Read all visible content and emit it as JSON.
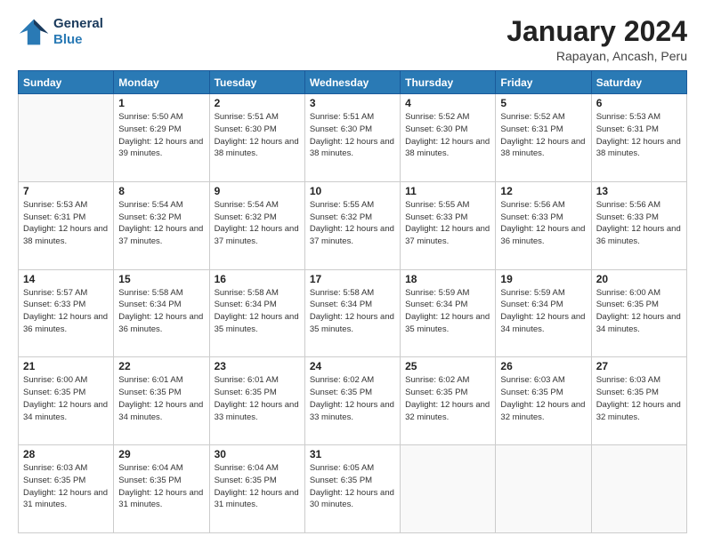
{
  "logo": {
    "line1": "General",
    "line2": "Blue"
  },
  "title": "January 2024",
  "subtitle": "Rapayan, Ancash, Peru",
  "days_header": [
    "Sunday",
    "Monday",
    "Tuesday",
    "Wednesday",
    "Thursday",
    "Friday",
    "Saturday"
  ],
  "weeks": [
    [
      {
        "day": "",
        "info": ""
      },
      {
        "day": "1",
        "info": "Sunrise: 5:50 AM\nSunset: 6:29 PM\nDaylight: 12 hours\nand 39 minutes."
      },
      {
        "day": "2",
        "info": "Sunrise: 5:51 AM\nSunset: 6:30 PM\nDaylight: 12 hours\nand 38 minutes."
      },
      {
        "day": "3",
        "info": "Sunrise: 5:51 AM\nSunset: 6:30 PM\nDaylight: 12 hours\nand 38 minutes."
      },
      {
        "day": "4",
        "info": "Sunrise: 5:52 AM\nSunset: 6:30 PM\nDaylight: 12 hours\nand 38 minutes."
      },
      {
        "day": "5",
        "info": "Sunrise: 5:52 AM\nSunset: 6:31 PM\nDaylight: 12 hours\nand 38 minutes."
      },
      {
        "day": "6",
        "info": "Sunrise: 5:53 AM\nSunset: 6:31 PM\nDaylight: 12 hours\nand 38 minutes."
      }
    ],
    [
      {
        "day": "7",
        "info": "Sunrise: 5:53 AM\nSunset: 6:31 PM\nDaylight: 12 hours\nand 38 minutes."
      },
      {
        "day": "8",
        "info": "Sunrise: 5:54 AM\nSunset: 6:32 PM\nDaylight: 12 hours\nand 37 minutes."
      },
      {
        "day": "9",
        "info": "Sunrise: 5:54 AM\nSunset: 6:32 PM\nDaylight: 12 hours\nand 37 minutes."
      },
      {
        "day": "10",
        "info": "Sunrise: 5:55 AM\nSunset: 6:32 PM\nDaylight: 12 hours\nand 37 minutes."
      },
      {
        "day": "11",
        "info": "Sunrise: 5:55 AM\nSunset: 6:33 PM\nDaylight: 12 hours\nand 37 minutes."
      },
      {
        "day": "12",
        "info": "Sunrise: 5:56 AM\nSunset: 6:33 PM\nDaylight: 12 hours\nand 36 minutes."
      },
      {
        "day": "13",
        "info": "Sunrise: 5:56 AM\nSunset: 6:33 PM\nDaylight: 12 hours\nand 36 minutes."
      }
    ],
    [
      {
        "day": "14",
        "info": "Sunrise: 5:57 AM\nSunset: 6:33 PM\nDaylight: 12 hours\nand 36 minutes."
      },
      {
        "day": "15",
        "info": "Sunrise: 5:58 AM\nSunset: 6:34 PM\nDaylight: 12 hours\nand 36 minutes."
      },
      {
        "day": "16",
        "info": "Sunrise: 5:58 AM\nSunset: 6:34 PM\nDaylight: 12 hours\nand 35 minutes."
      },
      {
        "day": "17",
        "info": "Sunrise: 5:58 AM\nSunset: 6:34 PM\nDaylight: 12 hours\nand 35 minutes."
      },
      {
        "day": "18",
        "info": "Sunrise: 5:59 AM\nSunset: 6:34 PM\nDaylight: 12 hours\nand 35 minutes."
      },
      {
        "day": "19",
        "info": "Sunrise: 5:59 AM\nSunset: 6:34 PM\nDaylight: 12 hours\nand 34 minutes."
      },
      {
        "day": "20",
        "info": "Sunrise: 6:00 AM\nSunset: 6:35 PM\nDaylight: 12 hours\nand 34 minutes."
      }
    ],
    [
      {
        "day": "21",
        "info": "Sunrise: 6:00 AM\nSunset: 6:35 PM\nDaylight: 12 hours\nand 34 minutes."
      },
      {
        "day": "22",
        "info": "Sunrise: 6:01 AM\nSunset: 6:35 PM\nDaylight: 12 hours\nand 34 minutes."
      },
      {
        "day": "23",
        "info": "Sunrise: 6:01 AM\nSunset: 6:35 PM\nDaylight: 12 hours\nand 33 minutes."
      },
      {
        "day": "24",
        "info": "Sunrise: 6:02 AM\nSunset: 6:35 PM\nDaylight: 12 hours\nand 33 minutes."
      },
      {
        "day": "25",
        "info": "Sunrise: 6:02 AM\nSunset: 6:35 PM\nDaylight: 12 hours\nand 32 minutes."
      },
      {
        "day": "26",
        "info": "Sunrise: 6:03 AM\nSunset: 6:35 PM\nDaylight: 12 hours\nand 32 minutes."
      },
      {
        "day": "27",
        "info": "Sunrise: 6:03 AM\nSunset: 6:35 PM\nDaylight: 12 hours\nand 32 minutes."
      }
    ],
    [
      {
        "day": "28",
        "info": "Sunrise: 6:03 AM\nSunset: 6:35 PM\nDaylight: 12 hours\nand 31 minutes."
      },
      {
        "day": "29",
        "info": "Sunrise: 6:04 AM\nSunset: 6:35 PM\nDaylight: 12 hours\nand 31 minutes."
      },
      {
        "day": "30",
        "info": "Sunrise: 6:04 AM\nSunset: 6:35 PM\nDaylight: 12 hours\nand 31 minutes."
      },
      {
        "day": "31",
        "info": "Sunrise: 6:05 AM\nSunset: 6:35 PM\nDaylight: 12 hours\nand 30 minutes."
      },
      {
        "day": "",
        "info": ""
      },
      {
        "day": "",
        "info": ""
      },
      {
        "day": "",
        "info": ""
      }
    ]
  ]
}
